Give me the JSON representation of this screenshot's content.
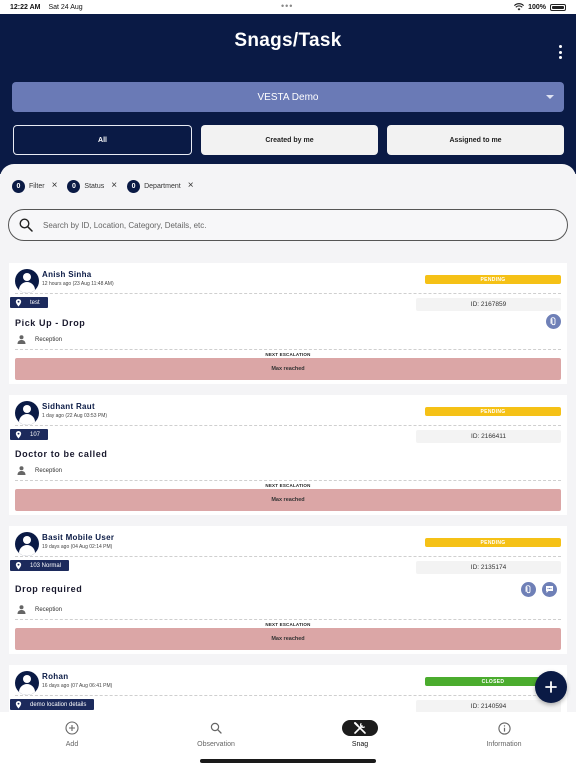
{
  "status_bar": {
    "time": "12:22 AM",
    "date": "Sat 24 Aug",
    "battery": "100%"
  },
  "header": {
    "title": "Snags/Task",
    "site": "VESTA Demo"
  },
  "tabs": [
    {
      "label": "All"
    },
    {
      "label": "Created by me"
    },
    {
      "label": "Assigned to me"
    }
  ],
  "filters": [
    {
      "count": "0",
      "label": "Filter"
    },
    {
      "count": "0",
      "label": "Status"
    },
    {
      "count": "0",
      "label": "Department"
    }
  ],
  "search": {
    "placeholder": "Search by ID, Location, Category, Details, etc."
  },
  "cards": [
    {
      "name": "Anish Sinha",
      "time": "12 hours ago (23 Aug 11:48 AM)",
      "status": "PENDING",
      "location": "test",
      "id": "ID: 2167859",
      "title": "Pick Up - Drop",
      "department": "Reception",
      "escalation_label": "NEXT ESCALATION",
      "escalation_value": "Max reached"
    },
    {
      "name": "Sidhant Raut",
      "time": "1 day ago (22 Aug 03:53 PM)",
      "status": "PENDING",
      "location": "107",
      "id": "ID: 2166411",
      "title": "Doctor to be called",
      "department": "Reception",
      "escalation_label": "NEXT ESCALATION",
      "escalation_value": "Max reached"
    },
    {
      "name": "Basit Mobile User",
      "time": "19 days ago (04 Aug 02:14 PM)",
      "status": "PENDING",
      "location": "103 Normal",
      "id": "ID: 2135174",
      "title": "Drop required",
      "department": "Reception",
      "escalation_label": "NEXT ESCALATION",
      "escalation_value": "Max reached"
    },
    {
      "name": "Rohan",
      "time": "16 days ago (07 Aug 06:41 PM)",
      "status": "CLOSED",
      "location": "demo location details",
      "id": "ID: 2140594"
    }
  ],
  "bottom_nav": [
    {
      "label": "Add",
      "icon": "add-circle-icon"
    },
    {
      "label": "Observation",
      "icon": "search-icon"
    },
    {
      "label": "Snag",
      "icon": "tools-icon"
    },
    {
      "label": "Information",
      "icon": "info-icon"
    }
  ],
  "colors": {
    "navy": "#0a1a45",
    "pending": "#f5c116",
    "closed": "#4bac2e",
    "escalation": "#dba6a6",
    "accent": "#6a7ab6"
  }
}
